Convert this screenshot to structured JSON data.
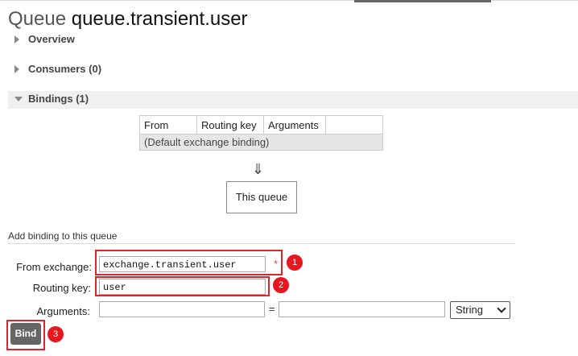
{
  "header": {
    "title_kind": "Queue",
    "title_name": "queue.transient.user"
  },
  "sections": {
    "overview": "Overview",
    "consumers": "Consumers (0)",
    "bindings": "Bindings (1)"
  },
  "bindings_table": {
    "columns": [
      "From",
      "Routing key",
      "Arguments"
    ],
    "rows": [
      [
        "(Default exchange binding)"
      ]
    ]
  },
  "flow": {
    "arrow": "⇓",
    "target": "This queue"
  },
  "add_binding": {
    "heading": "Add binding to this queue",
    "from_exchange_label": "From exchange:",
    "from_exchange_value": "exchange.transient.user",
    "required_mark": "*",
    "routing_key_label": "Routing key:",
    "routing_key_value": "user",
    "arguments_label": "Arguments:",
    "arguments_key_value": "",
    "arguments_value_value": "",
    "equals": "=",
    "type_selected": "String",
    "bind_button": "Bind"
  },
  "annotations": {
    "colors": {
      "highlight": "#d9272e",
      "badge": "#e8171f"
    },
    "badges": [
      "1",
      "2",
      "3"
    ]
  }
}
